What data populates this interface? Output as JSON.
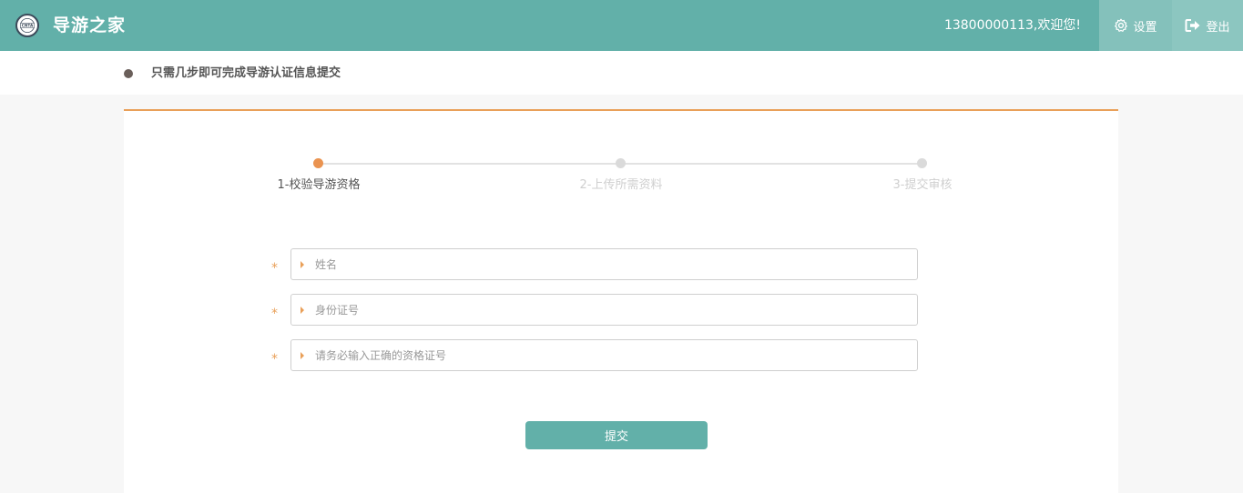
{
  "header": {
    "brand": "导游之家",
    "logo_text": "CNTA",
    "welcome": "13800000113,欢迎您!",
    "settings_label": "设置",
    "logout_label": "登出"
  },
  "subheader": {
    "tip": "只需几步即可完成导游认证信息提交"
  },
  "steps": [
    {
      "label": "1-校验导游资格",
      "state": "active"
    },
    {
      "label": "2-上传所需资料",
      "state": "inactive"
    },
    {
      "label": "3-提交审核",
      "state": "inactive"
    }
  ],
  "form": {
    "required_mark": "*",
    "fields": [
      {
        "placeholder": "姓名",
        "value": ""
      },
      {
        "placeholder": "身份证号",
        "value": ""
      },
      {
        "placeholder": "请务必输入正确的资格证号",
        "value": ""
      }
    ],
    "submit_label": "提交"
  },
  "colors": {
    "primary": "#62b0a9",
    "accent": "#e9a059",
    "step_active": "#ea9350",
    "step_inactive": "#dadada"
  }
}
